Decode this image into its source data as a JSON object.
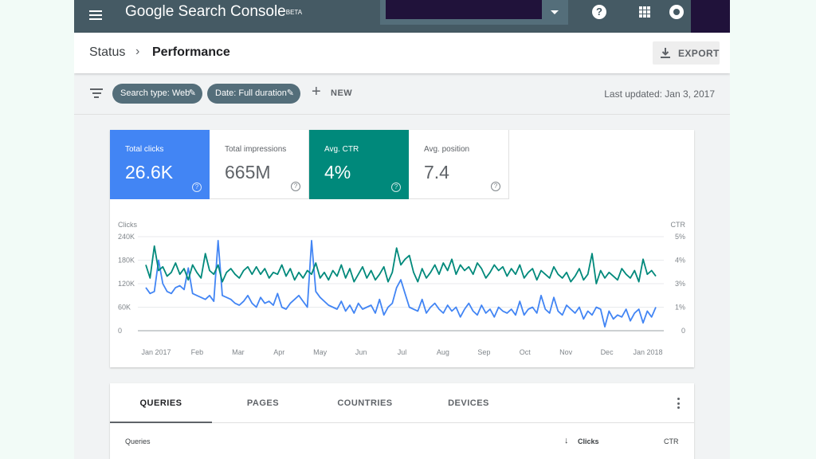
{
  "topbar": {
    "brand": "Google Search Console",
    "brand_badge": "BETA",
    "menu_icon": "menu-icon",
    "help_icon": "help-icon",
    "help_glyph": "?",
    "apps_icon": "apps-grid-icon",
    "account_icon": "account-icon"
  },
  "header": {
    "breadcrumb_parent": "Status",
    "breadcrumb_sep": "›",
    "breadcrumb_current": "Performance",
    "export_label": "EXPORT"
  },
  "filters": {
    "chips": [
      {
        "label": "Search type: Web"
      },
      {
        "label": "Date: Full duration"
      }
    ],
    "new_label": "NEW",
    "last_updated": "Last updated: Jan 3, 2017"
  },
  "metrics": [
    {
      "label": "Total clicks",
      "value": "26.6K",
      "selected": true,
      "color": "#4285f4"
    },
    {
      "label": "Total impressions",
      "value": "665M",
      "selected": false
    },
    {
      "label": "Avg. CTR",
      "value": "4%",
      "selected": true,
      "color": "#00897b"
    },
    {
      "label": "Avg. position",
      "value": "7.4",
      "selected": false
    }
  ],
  "chart_data": {
    "type": "line",
    "left_axis_label": "Clicks",
    "right_axis_label": "CTR",
    "left_ticks": [
      "240K",
      "180K",
      "120K",
      "60K",
      "0"
    ],
    "right_ticks": [
      "5%",
      "4%",
      "3%",
      "1%",
      "0"
    ],
    "x_ticks": [
      "Jan 2017",
      "Feb",
      "Mar",
      "Apr",
      "May",
      "Jun",
      "Jul",
      "Aug",
      "Sep",
      "Oct",
      "Nov",
      "Dec",
      "Jan 2018"
    ],
    "ylim_left": [
      0,
      240000
    ],
    "ylim_right": [
      0,
      5
    ],
    "series": [
      {
        "name": "Clicks",
        "axis": "left",
        "color": "#4285f4",
        "values": [
          110000,
          95000,
          100000,
          180000,
          120000,
          100000,
          95000,
          110000,
          115000,
          105000,
          160000,
          95000,
          90000,
          85000,
          80000,
          90000,
          75000,
          230000,
          90000,
          85000,
          80000,
          70000,
          65000,
          75000,
          90000,
          70000,
          60000,
          85000,
          70000,
          75000,
          65000,
          95000,
          60000,
          55000,
          70000,
          80000,
          90000,
          75000,
          60000,
          230000,
          100000,
          85000,
          75000,
          65000,
          60000,
          55000,
          75000,
          50000,
          65000,
          45000,
          70000,
          55000,
          60000,
          65000,
          45000,
          80000,
          40000,
          60000,
          70000,
          110000,
          130000,
          95000,
          60000,
          55000,
          50000,
          80000,
          45000,
          60000,
          70000,
          55000,
          45000,
          65000,
          50000,
          60000,
          35000,
          55000,
          70000,
          50000,
          40000,
          65000,
          45000,
          55000,
          35000,
          60000,
          50000,
          45000,
          55000,
          40000,
          75000,
          40000,
          55000,
          60000,
          45000,
          90000,
          55000,
          45000,
          85000,
          50000,
          40000,
          65000,
          55000,
          45000,
          60000,
          30000,
          50000,
          40000,
          60000,
          55000,
          10000,
          50000,
          30000,
          40000,
          35000,
          55000,
          25000,
          45000,
          55000,
          20000,
          50000,
          35000,
          60000
        ]
      },
      {
        "name": "CTR",
        "axis": "right",
        "color": "#00897b",
        "values": [
          3.5,
          2.8,
          4.5,
          3.2,
          3.4,
          2.9,
          3.1,
          3.6,
          3.0,
          3.3,
          2.7,
          3.5,
          3.1,
          2.8,
          4.1,
          3.2,
          3.0,
          3.5,
          2.6,
          3.1,
          3.3,
          3.0,
          2.8,
          3.2,
          3.4,
          3.0,
          3.4,
          3.0,
          3.3,
          2.8,
          3.1,
          3.0,
          3.5,
          2.9,
          3.3,
          2.7,
          3.1,
          2.8,
          3.2,
          3.0,
          3.6,
          2.8,
          3.1,
          2.7,
          3.2,
          2.9,
          3.5,
          2.8,
          3.3,
          2.6,
          3.0,
          3.4,
          2.8,
          3.2,
          2.7,
          3.0,
          3.4,
          2.6,
          3.1,
          4.4,
          3.5,
          3.8,
          4.0,
          3.1,
          2.6,
          3.3,
          2.8,
          3.1,
          3.5,
          3.0,
          3.6,
          3.2,
          3.8,
          3.0,
          3.5,
          3.2,
          3.4,
          3.0,
          3.6,
          3.3,
          2.8,
          3.1,
          3.5,
          3.2,
          3.4,
          2.9,
          3.3,
          3.0,
          3.5,
          2.8,
          3.1,
          3.3,
          2.7,
          3.2,
          3.0,
          2.8,
          3.4,
          3.0,
          2.8,
          3.1,
          2.6,
          2.9,
          3.3,
          2.7,
          3.0,
          4.1,
          2.5,
          3.2,
          2.8,
          3.1,
          2.9,
          2.7,
          3.3,
          3.0,
          2.8,
          3.2,
          2.6,
          3.8,
          3.0,
          3.2,
          2.9
        ]
      }
    ],
    "grid": true
  },
  "table": {
    "tabs": [
      "QUERIES",
      "PAGES",
      "COUNTRIES",
      "DEVICES"
    ],
    "active_tab": "QUERIES",
    "columns": {
      "queries": "Queries",
      "clicks": "Clicks",
      "ctr": "CTR"
    },
    "sort_arrow": "↓"
  }
}
